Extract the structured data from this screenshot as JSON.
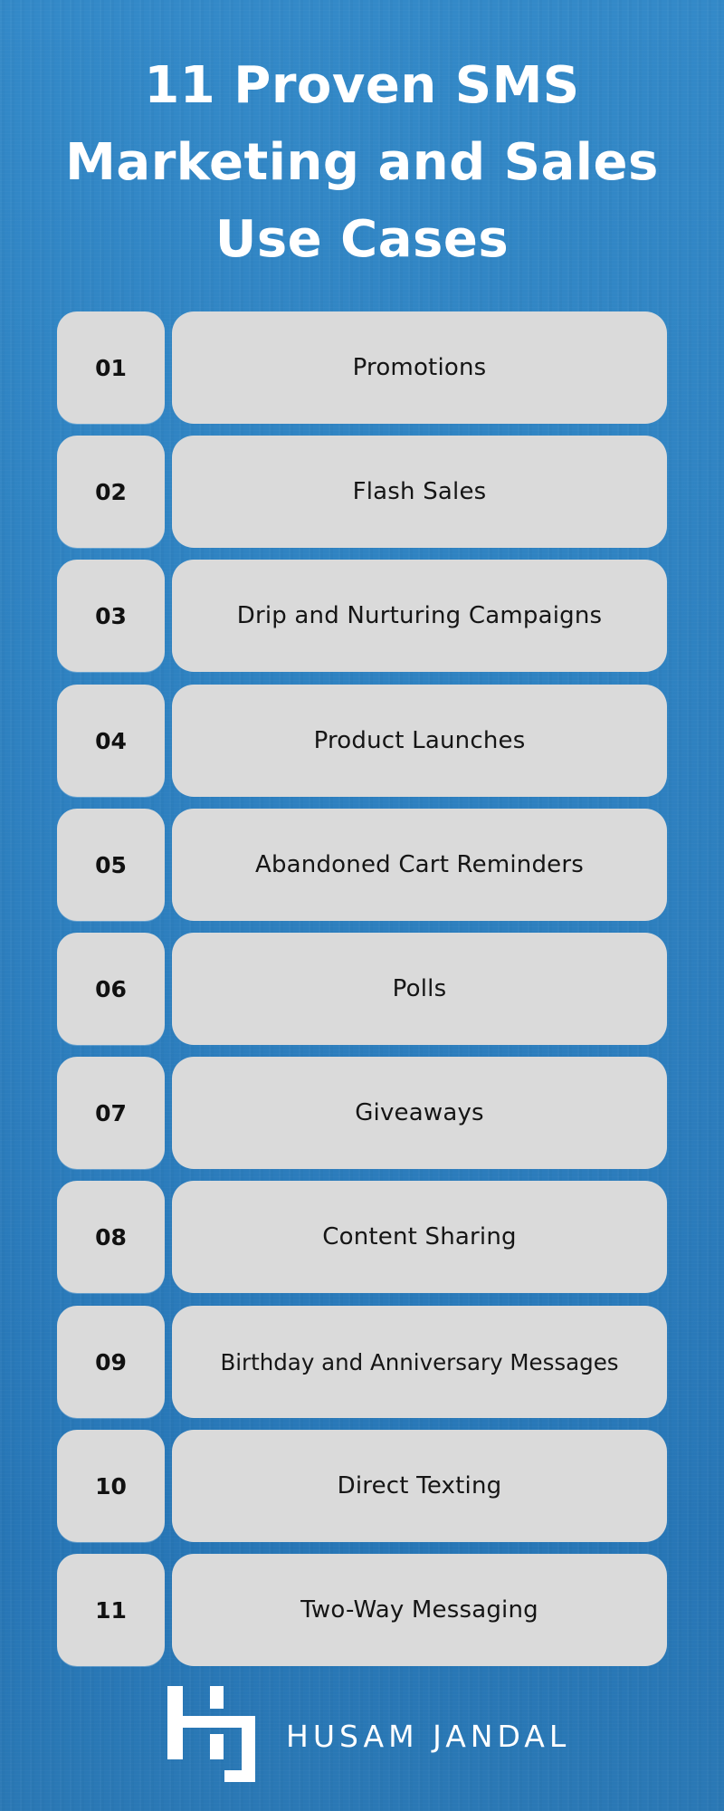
{
  "title": {
    "lines": [
      "11 Proven SMS",
      "Marketing and Sales",
      "Use Cases"
    ]
  },
  "use_cases": [
    {
      "number": "01",
      "label": "Promotions"
    },
    {
      "number": "02",
      "label": "Flash Sales"
    },
    {
      "number": "03",
      "label": "Drip and Nurturing Campaigns"
    },
    {
      "number": "04",
      "label": "Product Launches"
    },
    {
      "number": "05",
      "label": "Abandoned Cart Reminders"
    },
    {
      "number": "06",
      "label": "Polls"
    },
    {
      "number": "07",
      "label": "Giveaways"
    },
    {
      "number": "08",
      "label": "Content Sharing"
    },
    {
      "number": "09",
      "label": "Birthday and Anniversary Messages"
    },
    {
      "number": "10",
      "label": "Direct Texting"
    },
    {
      "number": "11",
      "label": "Two-Way Messaging"
    }
  ],
  "brand": {
    "logo_icon": "hj-monogram-icon",
    "name": "HUSAM JANDAL"
  },
  "colors": {
    "background": "#2f83c2",
    "card": "#dadada",
    "title_text": "#ffffff",
    "card_text": "#151515"
  }
}
